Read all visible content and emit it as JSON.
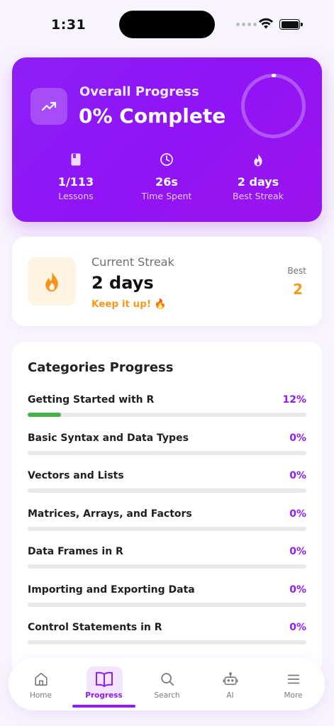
{
  "status_bar": {
    "time": "1:31"
  },
  "overall": {
    "label": "Overall Progress",
    "value": "0% Complete",
    "progress_fraction": 0.0,
    "stats": [
      {
        "icon": "book-icon",
        "value": "1/113",
        "label": "Lessons"
      },
      {
        "icon": "clock-icon",
        "value": "26s",
        "label": "Time Spent"
      },
      {
        "icon": "flame-icon",
        "value": "2 days",
        "label": "Best Streak"
      }
    ]
  },
  "streak": {
    "label": "Current Streak",
    "value": "2 days",
    "message": "Keep it up! 🔥",
    "best_label": "Best",
    "best_value": "2"
  },
  "categories": {
    "title": "Categories Progress",
    "items": [
      {
        "name": "Getting Started with R",
        "percent": "12%",
        "progress": 0.12
      },
      {
        "name": "Basic Syntax and Data Types",
        "percent": "0%",
        "progress": 0
      },
      {
        "name": "Vectors and Lists",
        "percent": "0%",
        "progress": 0
      },
      {
        "name": "Matrices, Arrays, and Factors",
        "percent": "0%",
        "progress": 0
      },
      {
        "name": "Data Frames in R",
        "percent": "0%",
        "progress": 0
      },
      {
        "name": "Importing and Exporting Data",
        "percent": "0%",
        "progress": 0
      },
      {
        "name": "Control Statements in R",
        "percent": "0%",
        "progress": 0
      }
    ]
  },
  "nav": {
    "items": [
      {
        "label": "Home",
        "icon": "home-icon",
        "active": false
      },
      {
        "label": "Progress",
        "icon": "book-open-icon",
        "active": true
      },
      {
        "label": "Search",
        "icon": "search-icon",
        "active": false
      },
      {
        "label": "AI",
        "icon": "robot-icon",
        "active": false
      },
      {
        "label": "More",
        "icon": "menu-icon",
        "active": false
      }
    ]
  },
  "colors": {
    "accent": "#8e1ff0",
    "streak_orange": "#f59a1b",
    "progress_green": "#45b14c"
  }
}
